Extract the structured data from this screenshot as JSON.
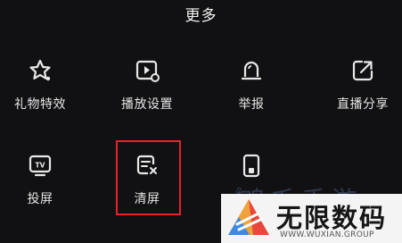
{
  "header": {
    "title": "更多"
  },
  "menu": {
    "items": [
      {
        "label": "礼物特效",
        "icon": "gift-effect-icon"
      },
      {
        "label": "播放设置",
        "icon": "play-settings-icon"
      },
      {
        "label": "举报",
        "icon": "report-icon"
      },
      {
        "label": "直播分享",
        "icon": "share-icon"
      },
      {
        "label": "投屏",
        "icon": "tv-cast-icon"
      },
      {
        "label": "清屏",
        "icon": "clear-screen-icon"
      },
      {
        "label": "",
        "icon": "tablet-icon"
      }
    ]
  },
  "watermark": {
    "faded_text": "鸡毛手游",
    "brand": "无限数码",
    "url": "WWW.WUXIAN.GROUP"
  },
  "colors": {
    "background": "#111113",
    "highlight": "#e8202a"
  }
}
